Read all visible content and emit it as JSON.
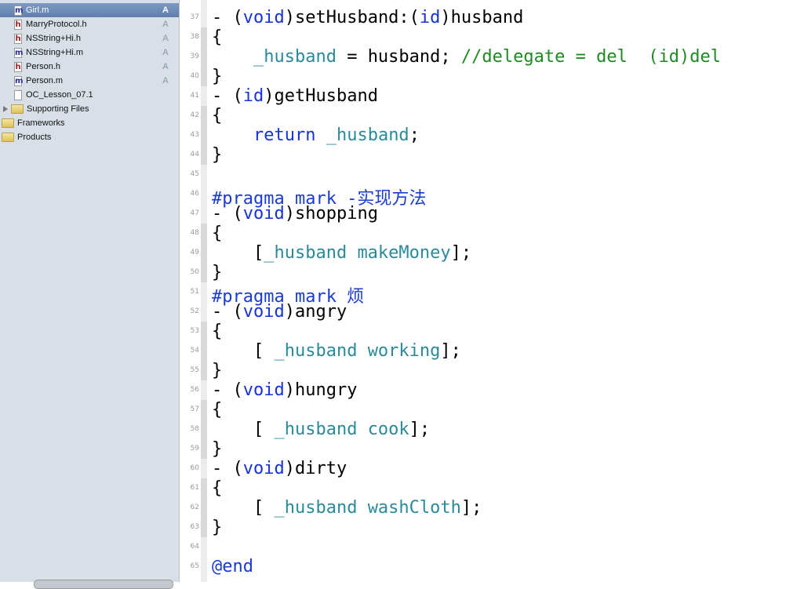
{
  "sidebar": {
    "items": [
      {
        "label": "Girl.m",
        "type": "m",
        "badge": "A",
        "selected": true
      },
      {
        "label": "MarryProtocol.h",
        "type": "h",
        "badge": "A"
      },
      {
        "label": "NSString+Hi.h",
        "type": "h",
        "badge": "A"
      },
      {
        "label": "NSString+Hi.m",
        "type": "m",
        "badge": "A"
      },
      {
        "label": "Person.h",
        "type": "h",
        "badge": "A"
      },
      {
        "label": "Person.m",
        "type": "m",
        "badge": "A"
      },
      {
        "label": "OC_Lesson_07.1",
        "type": "file",
        "badge": ""
      },
      {
        "label": "Supporting Files",
        "type": "folder",
        "disclosure": true,
        "badge": ""
      },
      {
        "label": "Frameworks",
        "type": "folder",
        "badge": ""
      },
      {
        "label": "Products",
        "type": "folder",
        "badge": ""
      }
    ]
  },
  "editor": {
    "first_line": 37,
    "lines": [
      [
        [
          "",
          "- ("
        ],
        [
          "kw",
          "void"
        ],
        [
          "",
          ")setHusband:("
        ],
        [
          "kw",
          "id"
        ],
        [
          "",
          ")husband"
        ]
      ],
      [
        [
          "",
          "{"
        ]
      ],
      [
        [
          "",
          "    "
        ],
        [
          "iv",
          "_husband"
        ],
        [
          "",
          " = husband; "
        ],
        [
          "cm",
          "//delegate = del  (id)del"
        ]
      ],
      [
        [
          "",
          "}"
        ]
      ],
      [
        [
          "",
          "- ("
        ],
        [
          "kw",
          "id"
        ],
        [
          "",
          ")getHusband"
        ]
      ],
      [
        [
          "",
          "{"
        ]
      ],
      [
        [
          "",
          "    "
        ],
        [
          "kw",
          "return"
        ],
        [
          "",
          " "
        ],
        [
          "iv",
          "_husband"
        ],
        [
          "",
          ";"
        ]
      ],
      [
        [
          "",
          "}"
        ]
      ],
      [],
      [
        [
          "pp",
          "#pragma mark -实现方法"
        ]
      ],
      [
        [
          "",
          "- ("
        ],
        [
          "kw",
          "void"
        ],
        [
          "",
          ")shopping"
        ]
      ],
      [
        [
          "",
          "{"
        ]
      ],
      [
        [
          "",
          "    ["
        ],
        [
          "iv",
          "_husband makeMoney"
        ],
        [
          "",
          "];"
        ]
      ],
      [
        [
          "",
          "}"
        ]
      ],
      [
        [
          "pp",
          "#pragma mark 烦"
        ]
      ],
      [
        [
          "",
          "- ("
        ],
        [
          "kw",
          "void"
        ],
        [
          "",
          ")angry"
        ]
      ],
      [
        [
          "",
          "{"
        ]
      ],
      [
        [
          "",
          "    [ "
        ],
        [
          "iv",
          "_husband working"
        ],
        [
          "",
          "];"
        ]
      ],
      [
        [
          "",
          "}"
        ]
      ],
      [
        [
          "",
          "- ("
        ],
        [
          "kw",
          "void"
        ],
        [
          "",
          ")hungry"
        ]
      ],
      [
        [
          "",
          "{"
        ]
      ],
      [
        [
          "",
          "    [ "
        ],
        [
          "iv",
          "_husband cook"
        ],
        [
          "",
          "];"
        ]
      ],
      [
        [
          "",
          "}"
        ]
      ],
      [
        [
          "",
          "- ("
        ],
        [
          "kw",
          "void"
        ],
        [
          "",
          ")dirty"
        ]
      ],
      [
        [
          "",
          "{"
        ]
      ],
      [
        [
          "",
          "    [ "
        ],
        [
          "iv",
          "_husband washCloth"
        ],
        [
          "",
          "];"
        ]
      ],
      [
        [
          "",
          "}"
        ]
      ],
      [],
      [
        [
          "pp",
          "@end"
        ]
      ]
    ]
  },
  "colors": {
    "keyword": "#1632d8",
    "ivar": "#2a8a9a",
    "comment": "#1d8a22",
    "selection": "#6f8db8"
  }
}
